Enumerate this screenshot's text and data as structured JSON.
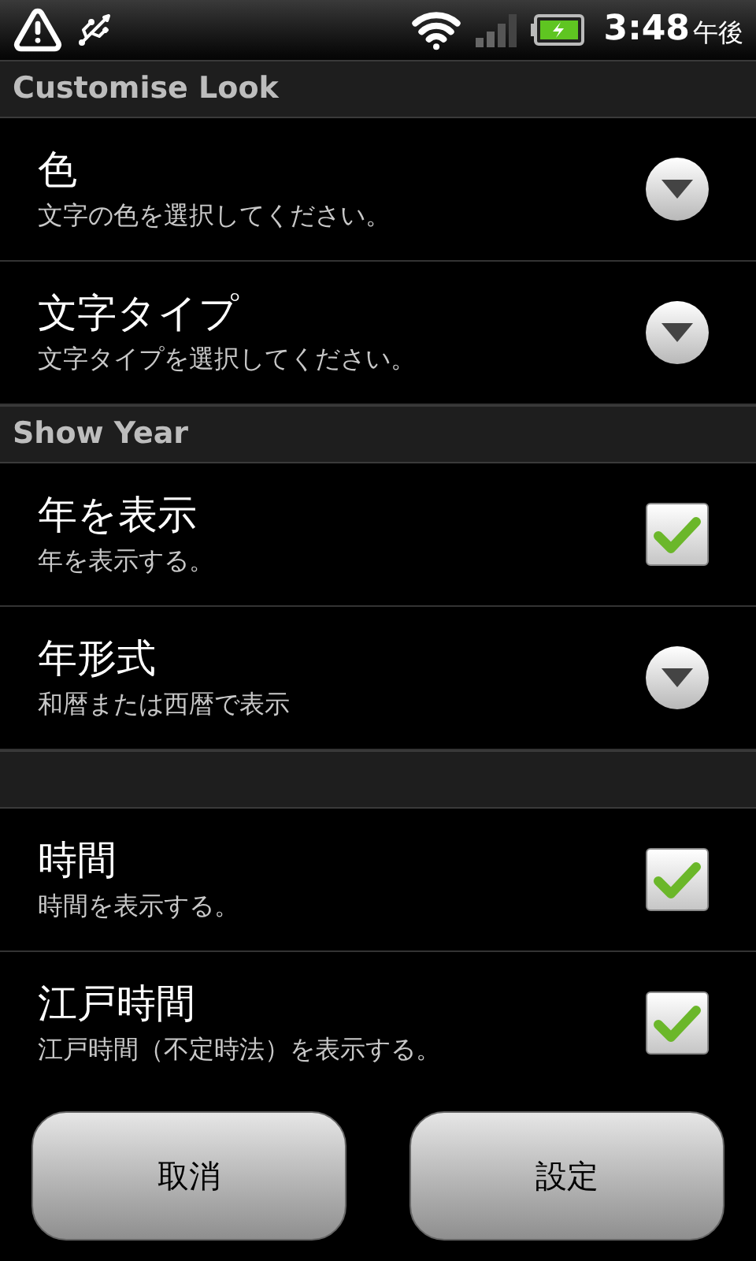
{
  "status_bar": {
    "time": "3:48",
    "ampm": "午後"
  },
  "list": [
    {
      "kind": "header",
      "title": "Customise Look"
    },
    {
      "kind": "dropdown",
      "title": "色",
      "summary": "文字の色を選択してください。"
    },
    {
      "kind": "dropdown",
      "title": "文字タイプ",
      "summary": "文字タイプを選択してください。"
    },
    {
      "kind": "header",
      "title": "Show Year"
    },
    {
      "kind": "checkbox",
      "title": "年を表示",
      "summary": "年を表示する。",
      "checked": true
    },
    {
      "kind": "dropdown",
      "title": "年形式",
      "summary": "和暦または西暦で表示"
    },
    {
      "kind": "header"
    },
    {
      "kind": "checkbox",
      "title": "時間",
      "summary": "時間を表示する。",
      "checked": true
    },
    {
      "kind": "checkbox",
      "title": "江戸時間",
      "summary": "江戸時間（不定時法）を表示する。",
      "checked": true
    }
  ],
  "buttons": [
    "取消",
    "設定"
  ]
}
